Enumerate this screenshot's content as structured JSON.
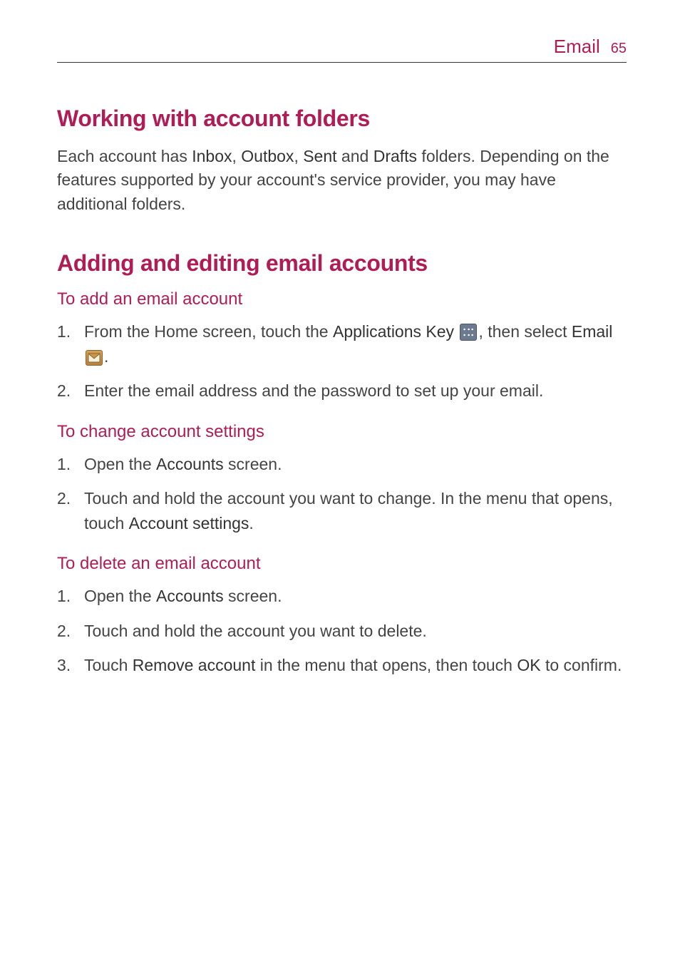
{
  "header": {
    "title": "Email",
    "page_number": "65"
  },
  "section1": {
    "heading": "Working with account folders",
    "body_pre": "Each account has ",
    "inbox": "Inbox",
    "sep1": ", ",
    "outbox": "Outbox",
    "sep2": ", ",
    "sent": "Sent",
    "sep3": " and ",
    "drafts": "Drafts",
    "body_post": " folders. Depending on the features supported by your account's service provider, you may have additional folders."
  },
  "section2": {
    "heading": "Adding and editing email accounts",
    "sub1": {
      "heading": "To add an email account",
      "item1": {
        "num": "1.",
        "text_pre": "From the Home screen, touch the ",
        "apps_key": "Applications Key",
        "text_mid": ", then select ",
        "email": "Email",
        "text_post": "."
      },
      "item2": {
        "num": "2.",
        "text": "Enter the email address and the password to set up your email."
      }
    },
    "sub2": {
      "heading": "To change account settings",
      "item1": {
        "num": "1.",
        "text_pre": "Open the ",
        "accounts": "Accounts",
        "text_post": " screen."
      },
      "item2": {
        "num": "2.",
        "text_pre": "Touch and hold the account you want to change. In the menu that opens, touch ",
        "account_settings": "Account settings",
        "text_post": "."
      }
    },
    "sub3": {
      "heading": "To delete an email account",
      "item1": {
        "num": "1.",
        "text_pre": "Open the ",
        "accounts": "Accounts",
        "text_post": " screen."
      },
      "item2": {
        "num": "2.",
        "text": "Touch and hold the account you want to delete."
      },
      "item3": {
        "num": "3.",
        "text_pre": "Touch ",
        "remove": "Remove account",
        "text_mid": " in the menu that opens, then touch ",
        "ok": "OK",
        "text_post": " to confirm."
      }
    }
  }
}
